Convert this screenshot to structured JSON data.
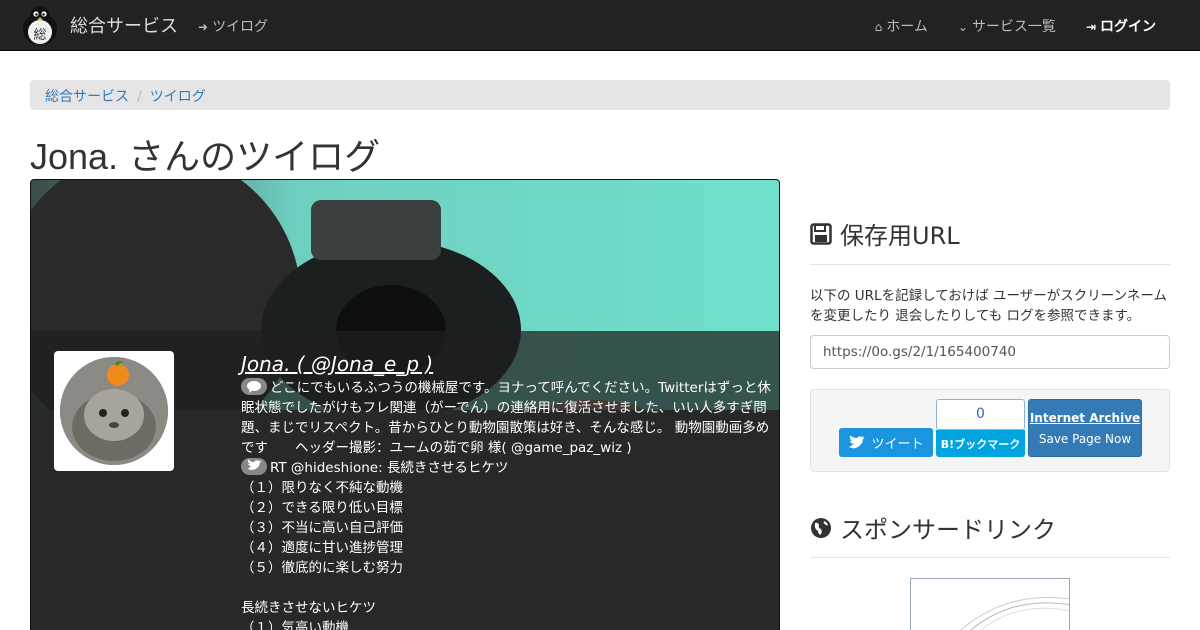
{
  "navbar": {
    "brand": "総合サービス",
    "current_app": "ツイログ",
    "items": [
      {
        "icon": "home-icon",
        "label": "ホーム"
      },
      {
        "icon": "chevron-down-icon",
        "label": "サービス一覧"
      },
      {
        "icon": "sign-in-icon",
        "label": "ログイン"
      }
    ]
  },
  "breadcrumb": [
    "総合サービス",
    "ツイログ"
  ],
  "page_title": "Jona. さんのツイログ",
  "profile": {
    "name": "Jona. ( @Jona_e_p )",
    "bio": "どこにでもいるふつうの機械屋です。ヨナって呼んでください。Twitterはずっと休眠状態でしたがけもフレ関連（がーでん）の連絡用に復活させました、いい人多すぎ問題、まじでリスペクト。昔からひとり動物園散策は好き、そんな感じ。 動物園動画多めです　　ヘッダー撮影：ユームの茹で卵 様( @game_paz_wiz )",
    "tweet_lines": [
      "RT @hideshione: 長続きさせるヒケツ",
      "（１）限りなく不純な動機",
      "（２）できる限り低い目標",
      "（３）不当に高い自己評価",
      "（４）適度に甘い進捗管理",
      "（５）徹底的に楽しむ努力",
      "",
      "長続きさせないヒケツ",
      "（１）気高い動機"
    ]
  },
  "sidebar": {
    "save_heading": "保存用URL",
    "save_desc": "以下の URLを記録しておけば ユーザーがスクリーンネームを変更したり 退会したりしても ログを参照できます。",
    "save_url": "https://0o.gs/2/1/165400740",
    "tweet_button": "ツイート",
    "hatena_count": "0",
    "hatena_button": "B!ブックマーク",
    "ia_title": "Internet Archive",
    "ia_action": "Save Page Now",
    "sponsor_heading": "スポンサードリンク"
  },
  "colors": {
    "navbar_bg": "#222222",
    "link": "#337ab7",
    "twitter": "#1b95e0",
    "hatena": "#00a4de"
  }
}
